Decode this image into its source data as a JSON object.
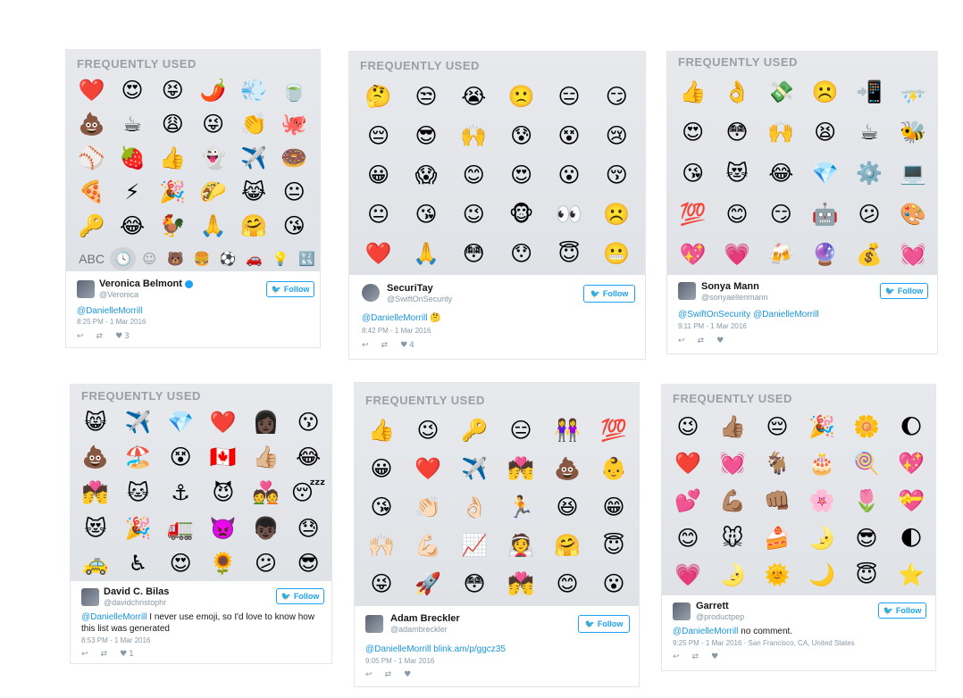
{
  "frequently_used_label": "FREQUENTLY USED",
  "follow_label": "Follow",
  "cards": [
    {
      "emojis": [
        "❤️",
        "😍",
        "😝",
        "🌶️",
        "💨",
        "🍵",
        "💩",
        "☕",
        "😩",
        "😜",
        "👏",
        "🐙",
        "⚾",
        "🍓",
        "👍",
        "👻",
        "✈️",
        "🍩",
        "🍕",
        "⚡",
        "🎉",
        "🌮",
        "😹",
        "😐",
        "🔑",
        "😂",
        "🐓",
        "🙏",
        "🤗",
        "😘"
      ],
      "keyboard_bar": [
        "ABC",
        "🕓",
        "☺",
        "🐻",
        "🍔",
        "⚽",
        "🚗",
        "💡",
        "🔣"
      ],
      "name": "Veronica Belmont",
      "verified": true,
      "handle": "@Veronica",
      "text_link": "@DanielleMorrill",
      "text_rest": "",
      "time": "8:25 PM - 1 Mar 2016",
      "likes": "3",
      "reply_icon": "reply-icon",
      "retweet_icon": "retweet-icon",
      "like_icon": "heart-icon"
    },
    {
      "emojis": [
        "🤔",
        "😒",
        "😭",
        "🙁",
        "😑",
        "😏",
        "😔",
        "😎",
        "🙌",
        "😰",
        "😵",
        "😢",
        "😀",
        "😱",
        "😊",
        "😍",
        "😮",
        "😚",
        "😐",
        "😘",
        "😉",
        "🐵",
        "👀",
        "☹️",
        "❤️",
        "🙏",
        "😳",
        "😯",
        "😇",
        "😬"
      ],
      "name": "SecuriTay",
      "verified": false,
      "handle": "@SwiftOnSecurity",
      "text_link": "@DanielleMorrill",
      "text_rest": "🤔",
      "time": "8:42 PM - 1 Mar 2016",
      "likes": "4"
    },
    {
      "emojis": [
        "👍",
        "👌",
        "💸",
        "☹️",
        "📲",
        "⛈️",
        "😍",
        "😳",
        "🙌",
        "😫",
        "☕",
        "🐝",
        "😘",
        "😻",
        "😂",
        "💎",
        "⚙️",
        "💻",
        "💯",
        "😊",
        "😏",
        "🤖",
        "😕",
        "🎨",
        "💖",
        "💗",
        "🍻",
        "🔮",
        "💰",
        "💓"
      ],
      "name": "Sonya Mann",
      "verified": false,
      "handle": "@sonyaellenmann",
      "text_link": "@SwiftOnSecurity @DanielleMorrill",
      "text_rest": "",
      "time": "9:11 PM - 1 Mar 2016",
      "likes": ""
    },
    {
      "emojis": [
        "😸",
        "✈️",
        "💎",
        "❤️",
        "👩🏿",
        "😗",
        "💩",
        "🏖️",
        "😵",
        "🇨🇦",
        "👍🏼",
        "😂",
        "💏",
        "🐱",
        "⚓",
        "😈",
        "💑",
        "😴",
        "😻",
        "🎉",
        "🚛",
        "👿",
        "👦🏿",
        "😓",
        "🚕",
        "♿",
        "😍",
        "🌻",
        "😕",
        "😎"
      ],
      "name": "David C. Bilas",
      "verified": false,
      "handle": "@davidchristophr",
      "text_link": "@DanielleMorrill",
      "text_rest": " I never use emoji, so I'd love to know how this list was generated",
      "time": "8:53 PM - 1 Mar 2016",
      "likes": "1"
    },
    {
      "emojis": [
        "👍",
        "😉",
        "🔑",
        "😑",
        "👭",
        "💯",
        "😀",
        "❤️",
        "✈️",
        "💏",
        "💩",
        "👶",
        "😘",
        "👏🏻",
        "👌🏻",
        "🏃",
        "😆",
        "😁",
        "🙌🏻",
        "💪🏻",
        "📈",
        "👰",
        "🤗",
        "😇",
        "😜",
        "🚀",
        "😳",
        "💏",
        "😊",
        "😮"
      ],
      "name": "Adam Breckler",
      "verified": false,
      "handle": "@adambreckler",
      "text_link": "@DanielleMorrill blink.am/p/ggcz35",
      "text_rest": "",
      "time": "9:05 PM - 1 Mar 2016",
      "likes": ""
    },
    {
      "emojis": [
        "😉",
        "👍🏽",
        "😔",
        "🎉",
        "🌼",
        "🌔",
        "❤️",
        "💓",
        "🐐",
        "🎂",
        "🍭",
        "💖",
        "💕",
        "💪🏽",
        "👊🏽",
        "🌸",
        "🌷",
        "💝",
        "😊",
        "🐭",
        "🍰",
        "🌛",
        "😎",
        "🌓",
        "💗",
        "🌛",
        "🌞",
        "🌙",
        "😇",
        "⭐"
      ],
      "name": "Garrett",
      "verified": false,
      "handle": "@productpep",
      "text_link": "@DanielleMorrill",
      "text_rest": " no comment.",
      "time": "9:25 PM - 1 Mar 2016 · San Francisco, CA, United States",
      "likes": ""
    }
  ]
}
